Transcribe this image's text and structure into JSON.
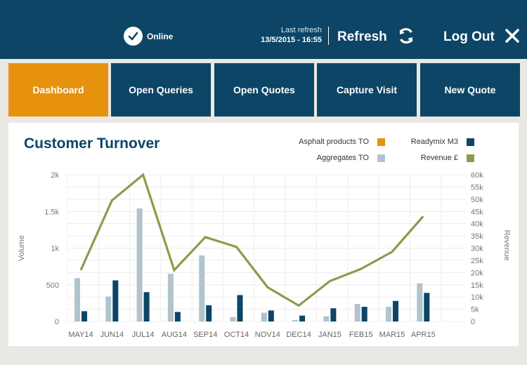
{
  "header": {
    "status_label": "Online",
    "last_refresh_label": "Last refresh",
    "last_refresh_time": "13/5/2015 - 16:55",
    "refresh_label": "Refresh",
    "logout_label": "Log Out"
  },
  "nav": {
    "items": [
      {
        "label": "Dashboard",
        "active": true
      },
      {
        "label": "Open Queries",
        "active": false
      },
      {
        "label": "Open Quotes",
        "active": false
      },
      {
        "label": "Capture Visit",
        "active": false
      },
      {
        "label": "New Quote",
        "active": false
      }
    ]
  },
  "colors": {
    "header_bg": "#0c4566",
    "active_tab": "#e7920f",
    "asphalt": "#e7920f",
    "aggregates": "#b1c3cc",
    "readymix": "#0c4566",
    "revenue": "#8a9c4a"
  },
  "chart_data": {
    "type": "bar",
    "title": "Customer Turnover",
    "ylabel": "Volume",
    "y2label": "Revenue",
    "categories": [
      "MAY14",
      "JUN14",
      "JUL14",
      "AUG14",
      "SEP14",
      "OCT14",
      "NOV14",
      "DEC14",
      "JAN15",
      "FEB15",
      "MAR15",
      "APR15"
    ],
    "ylim": [
      0,
      2000
    ],
    "y_ticks": [
      "0",
      "500",
      "1k",
      "1.5k",
      "2k"
    ],
    "y2lim": [
      0,
      60000
    ],
    "y2_ticks": [
      "0",
      "5k",
      "10k",
      "15k",
      "20k",
      "25k",
      "30k",
      "35k",
      "40k",
      "45k",
      "50k",
      "55k",
      "60k"
    ],
    "legend": [
      {
        "name": "Asphalt products TO",
        "color": "#e7920f"
      },
      {
        "name": "Readymix M3",
        "color": "#0c4566"
      },
      {
        "name": "Aggregates TO",
        "color": "#b1c3cc"
      },
      {
        "name": "Revenue £",
        "color": "#8a9c4a"
      }
    ],
    "series": [
      {
        "name": "Aggregates TO",
        "kind": "bar",
        "axis": "left",
        "color": "#b1c3cc",
        "values": [
          590,
          340,
          1540,
          650,
          900,
          60,
          120,
          20,
          70,
          240,
          200,
          520
        ]
      },
      {
        "name": "Readymix M3",
        "kind": "bar",
        "axis": "left",
        "color": "#0c4566",
        "values": [
          140,
          560,
          400,
          130,
          220,
          360,
          150,
          80,
          180,
          200,
          280,
          390
        ]
      },
      {
        "name": "Revenue £",
        "kind": "line",
        "axis": "right",
        "color": "#8a9c4a",
        "values": [
          21000,
          49500,
          60000,
          21000,
          34500,
          30500,
          14000,
          6500,
          16500,
          21500,
          28500,
          43000
        ]
      }
    ],
    "grid": true,
    "legend_position": "top-right"
  }
}
